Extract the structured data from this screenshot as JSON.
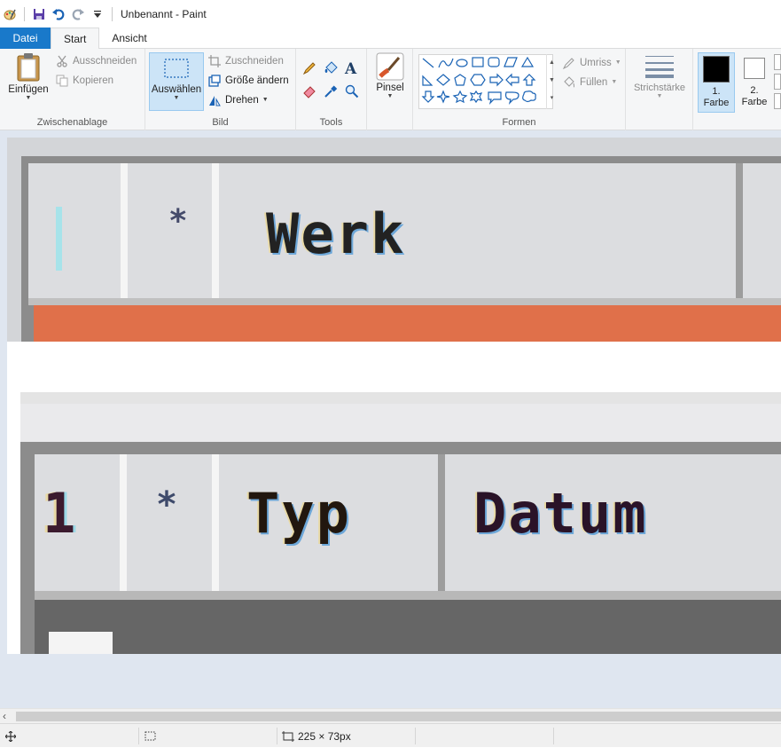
{
  "window": {
    "title": "Unbenannt - Paint"
  },
  "tabs": [
    {
      "label": "Datei"
    },
    {
      "label": "Start"
    },
    {
      "label": "Ansicht"
    }
  ],
  "ribbon": {
    "clipboard": {
      "label": "Zwischenablage",
      "paste": "Einfügen",
      "cut": "Ausschneiden",
      "copy": "Kopieren"
    },
    "image": {
      "label": "Bild",
      "select": "Auswählen",
      "crop": "Zuschneiden",
      "resize": "Größe ändern",
      "rotate": "Drehen"
    },
    "tools": {
      "label": "Tools"
    },
    "brushes": {
      "label": "Pinsel"
    },
    "shapes": {
      "label": "Formen",
      "outline": "Umriss",
      "fill": "Füllen"
    },
    "size": {
      "label": "Strichstärke"
    },
    "colors": {
      "color1": "1. Farbe",
      "color2": "2. Farbe",
      "color1_value": "#000000",
      "color2_value": "#ffffff"
    }
  },
  "canvas": {
    "header1": {
      "col1": "I",
      "col2": "*",
      "col3": "Werk"
    },
    "header2": {
      "col1": "1",
      "col2": "*",
      "col3": "Typ",
      "col4": "Datum"
    }
  },
  "status": {
    "selection_size": "225 × 73px"
  }
}
